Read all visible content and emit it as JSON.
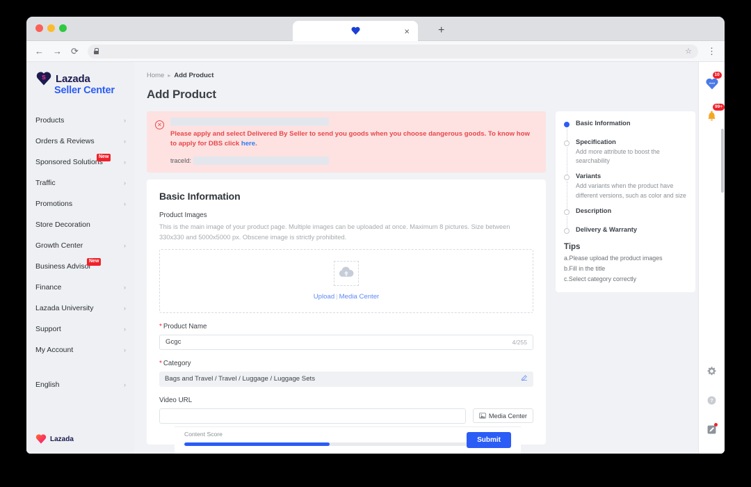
{
  "browser": {
    "tab_title": "",
    "tab_favicon": "lazada-heart-icon",
    "close_label": "×",
    "newtab_label": "+",
    "back_label": "←",
    "forward_label": "→",
    "reload_label": "⟳",
    "url_value": "",
    "star_label": "☆",
    "menu_label": "⋮"
  },
  "sidebar": {
    "brand": {
      "name": "Lazada",
      "sub": "Seller Center",
      "logo": "lazada-heart-icon"
    },
    "items": [
      {
        "label": "Products",
        "chevron": "›",
        "badge": ""
      },
      {
        "label": "Orders & Reviews",
        "chevron": "›",
        "badge": ""
      },
      {
        "label": "Sponsored Solutions",
        "chevron": "›",
        "badge": "New"
      },
      {
        "label": "Traffic",
        "chevron": "›",
        "badge": ""
      },
      {
        "label": "Promotions",
        "chevron": "›",
        "badge": ""
      },
      {
        "label": "Store Decoration",
        "chevron": "",
        "badge": ""
      },
      {
        "label": "Growth Center",
        "chevron": "›",
        "badge": ""
      },
      {
        "label": "Business Advisor",
        "chevron": "",
        "badge": "New"
      },
      {
        "label": "Finance",
        "chevron": "›",
        "badge": ""
      },
      {
        "label": "Lazada University",
        "chevron": "›",
        "badge": ""
      },
      {
        "label": "Support",
        "chevron": "›",
        "badge": ""
      },
      {
        "label": "My Account",
        "chevron": "›",
        "badge": ""
      }
    ],
    "language": {
      "label": "English",
      "chevron": "›"
    },
    "footer": {
      "name": "Lazada"
    }
  },
  "header": {
    "breadcrumb_home": "Home",
    "breadcrumb_sep": "▸",
    "breadcrumb_current": "Add Product",
    "page_title": "Add Product"
  },
  "alert": {
    "icon": "error-circle-icon",
    "icon_glyph": "✕",
    "message_before": "Please apply and select Delivered By Seller to send you goods when you choose dangerous goods. To know how to apply for DBS click ",
    "link_text": "here",
    "message_after": ".",
    "trace_label": "traceId:"
  },
  "card": {
    "title": "Basic Information",
    "product_images_label": "Product Images",
    "product_images_helper": "This is the main image of your product page. Multiple images can be uploaded at once. Maximum 8 pictures. Size between 330x330 and 5000x5000 px. Obscene image is strictly prohibited.",
    "upload_icon": "cloud-upload-icon",
    "upload_link": "Upload",
    "upload_divider": "|",
    "media_center_link": "Media Center",
    "product_name_label": "Product Name",
    "product_name_value": "Gcgc",
    "product_name_counter": "4/255",
    "category_label": "Category",
    "category_value": "Bags and Travel / Travel / Luggage / Luggage Sets",
    "category_edit_icon": "pencil-icon",
    "video_url_label": "Video URL",
    "video_url_value": "",
    "media_center_button": "Media Center",
    "media_center_button_icon": "image-icon"
  },
  "footerbar": {
    "score_label": "Content Score",
    "score_value": "50/100",
    "score_percent": 50,
    "info_icon": "ⓘ",
    "submit_label": "Submit",
    "accent_color": "#2b5cf6"
  },
  "steps": [
    {
      "title": "Basic Information",
      "desc": "",
      "state": "active"
    },
    {
      "title": "Specification",
      "desc": "Add more attribute to boost the searchability",
      "state": "idle"
    },
    {
      "title": "Variants",
      "desc": "Add variants when the product have different versions, such as color and size",
      "state": "idle"
    },
    {
      "title": "Description",
      "desc": "",
      "state": "idle"
    },
    {
      "title": "Delivery & Warranty",
      "desc": "",
      "state": "idle"
    }
  ],
  "tips": {
    "heading": "Tips",
    "items": [
      "a.Please upload the product images",
      "b.Fill in the title",
      "c.Select category correctly"
    ]
  },
  "rail": {
    "chat": {
      "icon": "chat-bubble-icon",
      "badge": "10"
    },
    "bell": {
      "icon": "bell-icon",
      "badge": "99+"
    },
    "gear": {
      "icon": "gear-icon"
    },
    "help": {
      "icon": "question-circle-icon"
    },
    "feedback": {
      "icon": "pencil-square-icon"
    }
  }
}
